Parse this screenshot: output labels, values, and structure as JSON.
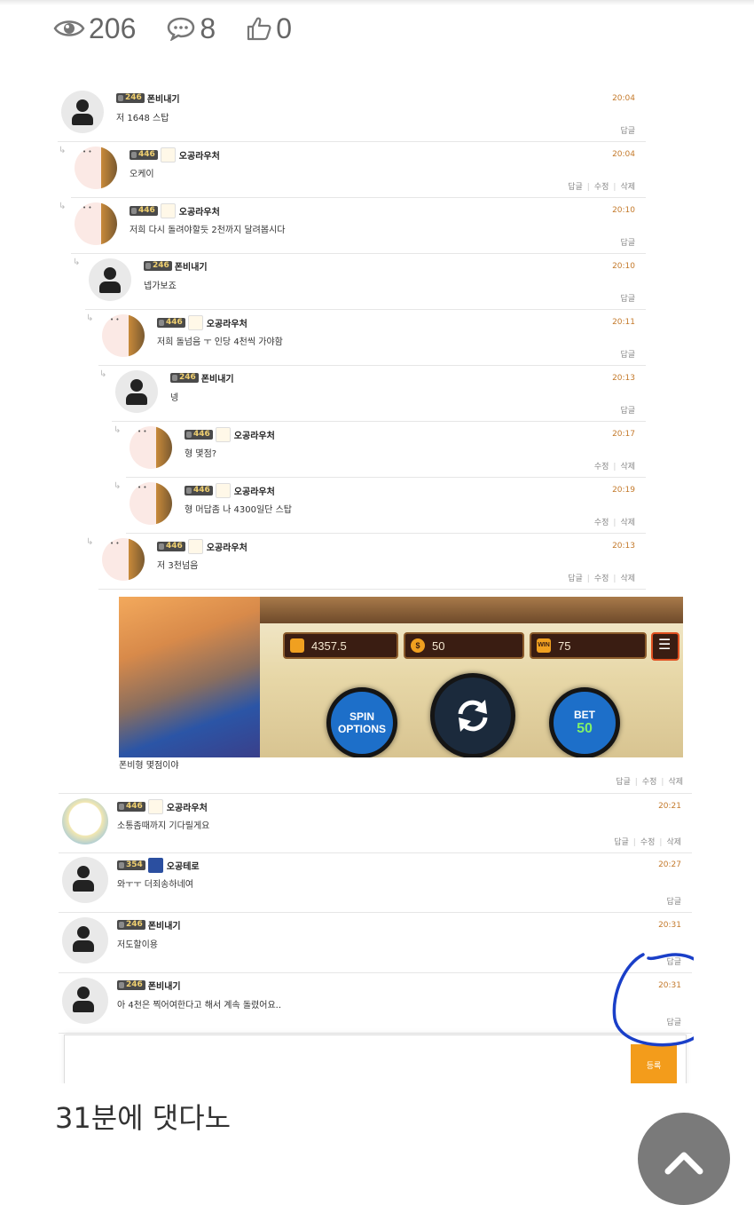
{
  "stats": {
    "views": "206",
    "comments": "8",
    "likes": "0"
  },
  "comments": [
    {
      "level": "246",
      "author": "폰비내기",
      "time": "20:04",
      "text": "저 1648 스탑",
      "actions": [
        "답글"
      ],
      "avatar": "default"
    },
    {
      "level": "446",
      "author": "오공라우처",
      "time": "20:04",
      "text": "오케이",
      "actions": [
        "답글",
        "수정",
        "삭제"
      ],
      "avatar": "ghost"
    },
    {
      "level": "446",
      "author": "오공라우처",
      "time": "20:10",
      "text": "저희 다시 돌려야할듯 2천까지 달려봅시다",
      "actions": [
        "답글"
      ],
      "avatar": "ghost"
    },
    {
      "level": "246",
      "author": "폰비내기",
      "time": "20:10",
      "text": "넵가보죠",
      "actions": [
        "답글"
      ],
      "avatar": "default"
    },
    {
      "level": "446",
      "author": "오공라우처",
      "time": "20:11",
      "text": "저희 돌넘음 ㅜ 인당 4천씩 가야함",
      "actions": [
        "답글"
      ],
      "avatar": "ghost"
    },
    {
      "level": "246",
      "author": "폰비내기",
      "time": "20:13",
      "text": "넹",
      "actions": [
        "답글"
      ],
      "avatar": "default"
    },
    {
      "level": "446",
      "author": "오공라우처",
      "time": "20:17",
      "text": "형 몇점?",
      "actions": [
        "수정",
        "삭제"
      ],
      "avatar": "ghost"
    },
    {
      "level": "446",
      "author": "오공라우처",
      "time": "20:19",
      "text": "형 머답좀 나 4300일단 스탑",
      "actions": [
        "수정",
        "삭제"
      ],
      "avatar": "ghost"
    },
    {
      "level": "446",
      "author": "오공라우처",
      "time": "20:13",
      "text": "저 3천넘음",
      "actions": [
        "답글",
        "수정",
        "삭제"
      ],
      "avatar": "ghost"
    }
  ],
  "game": {
    "balance": "4357.5",
    "coin": "50",
    "win": "75",
    "win_icon": "WIN",
    "spin_label": "SPIN OPTIONS",
    "bet_label": "BET",
    "bet_value": "50"
  },
  "image_caption": "폰비형 몇점이야",
  "image_actions": [
    "답글",
    "수정",
    "삭제"
  ],
  "comments2": [
    {
      "level": "446",
      "author": "오공라우처",
      "time": "20:21",
      "text": "소통좀때까지 기다릴게요",
      "actions": [
        "답글",
        "수정",
        "삭제"
      ],
      "avatar": "ghost2"
    },
    {
      "level": "354",
      "author": "오공테로",
      "time": "20:27",
      "text": "와ㅜㅜ 더죄송하네여",
      "actions": [
        "답글"
      ],
      "avatar": "default"
    },
    {
      "level": "246",
      "author": "폰비내기",
      "time": "20:31",
      "text": "저도할이용",
      "actions": [
        "답글"
      ],
      "avatar": "default"
    },
    {
      "level": "246",
      "author": "폰비내기",
      "time": "20:31",
      "text": "아 4천은 찍어여한다고 해서 계속 돌렸어요..",
      "actions": [
        "답글"
      ],
      "avatar": "default"
    }
  ],
  "submit_label": "등록",
  "post_text": "31분에 댓다노",
  "colors": {
    "time": "#c47a2c",
    "submit": "#f39c1b",
    "highlight": "#1a3fc8"
  }
}
